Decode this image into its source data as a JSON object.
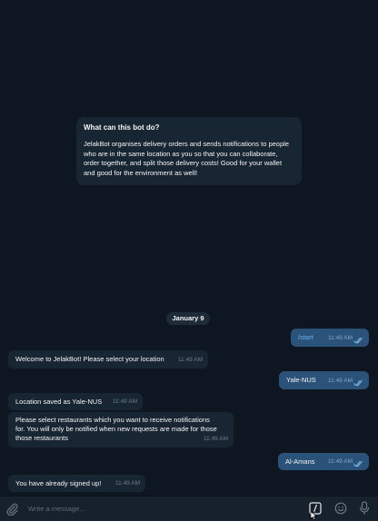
{
  "bot_info": {
    "title": "What can this bot do?",
    "text": "JelakBot organises delivery orders and sends notifications to people who are in the same location as you so that you can collaborate, order together, and split those delivery costs! Good for your wallet and good for the environment as well!"
  },
  "date_separator": "January 9",
  "messages": [
    {
      "direction": "out",
      "text": "/start",
      "time": "11:49 AM"
    },
    {
      "direction": "in",
      "text": "Welcome to JelakBot! Please select your location",
      "time": "11:49 AM"
    },
    {
      "direction": "out",
      "text": "Yale-NUS",
      "time": "11:49 AM"
    },
    {
      "direction": "in",
      "text": "Location saved as Yale-NUS",
      "time": "11:49 AM"
    },
    {
      "direction": "in",
      "text": "Please select restaurants which you want to receive notifications for. You will only be notified when new requests are made for those those restaurants",
      "time": "11:49 AM"
    },
    {
      "direction": "out",
      "text": "Al-Amans",
      "time": "11:49 AM"
    },
    {
      "direction": "in",
      "text": "You have already signed up!",
      "time": "11:49 AM"
    }
  ],
  "input": {
    "placeholder": "Write a message..."
  },
  "icons": {
    "attach": "paperclip-icon",
    "commands": "slash-command-icon",
    "emoji": "emoji-icon",
    "voice": "microphone-icon"
  },
  "colors": {
    "background": "#0e1621",
    "incoming_bubble": "#182533",
    "outgoing_bubble": "#2b5278",
    "link": "#6ab2f2"
  }
}
